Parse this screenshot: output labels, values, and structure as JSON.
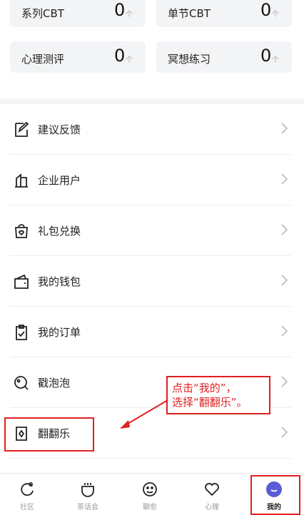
{
  "stats": [
    {
      "label": "系列CBT",
      "value": "0",
      "unit": "个"
    },
    {
      "label": "单节CBT",
      "value": "0",
      "unit": "个"
    },
    {
      "label": "心理测评",
      "value": "0",
      "unit": "个"
    },
    {
      "label": "冥想练习",
      "value": "0",
      "unit": "个"
    }
  ],
  "menu": [
    {
      "label": "建议反馈",
      "icon": "edit-icon"
    },
    {
      "label": "企业用户",
      "icon": "building-icon"
    },
    {
      "label": "礼包兑换",
      "icon": "gift-bag-icon"
    },
    {
      "label": "我的钱包",
      "icon": "wallet-icon"
    },
    {
      "label": "我的订单",
      "icon": "clipboard-icon"
    },
    {
      "label": "戳泡泡",
      "icon": "bubble-icon"
    },
    {
      "label": "翻翻乐",
      "icon": "card-flip-icon"
    }
  ],
  "annotation": {
    "text": "点击“我的”，\n选择“翻翻乐”。",
    "color": "#e02020"
  },
  "tabs": [
    {
      "label": "社区",
      "icon": "community-icon"
    },
    {
      "label": "茶话会",
      "icon": "tea-cup-icon"
    },
    {
      "label": "聊愈",
      "icon": "smile-face-icon"
    },
    {
      "label": "心理",
      "icon": "heart-icon"
    },
    {
      "label": "我的",
      "icon": "profile-avatar-icon",
      "active": true
    }
  ],
  "colors": {
    "accent": "#5b5bd6",
    "highlight": "#e02020"
  }
}
